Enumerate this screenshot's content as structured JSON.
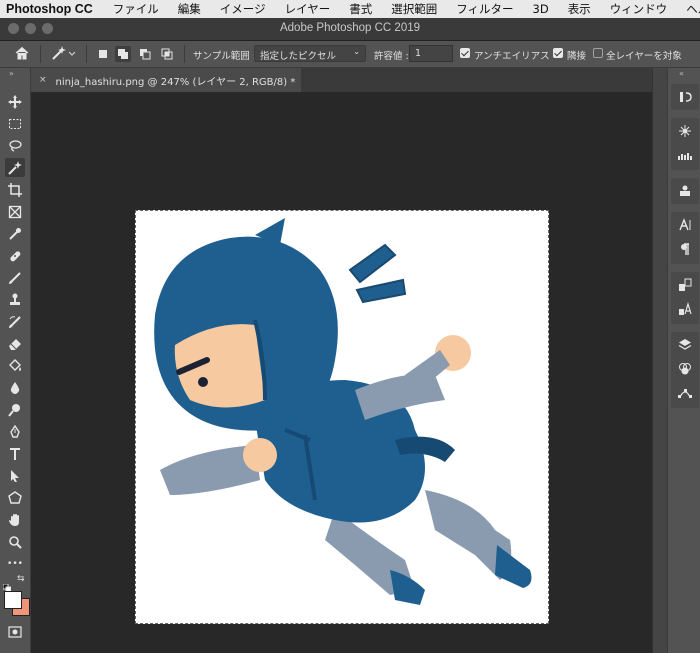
{
  "menubar": {
    "app": "Photoshop CC",
    "items": [
      "ファイル",
      "編集",
      "イメージ",
      "レイヤー",
      "書式",
      "選択範囲",
      "フィルター",
      "3D",
      "表示",
      "ウィンドウ",
      "ヘルプ"
    ]
  },
  "window": {
    "title": "Adobe Photoshop CC 2019"
  },
  "options": {
    "sample_label": "サンプル範囲 :",
    "sample_value": "指定したピクセル",
    "tolerance_label": "許容値 :",
    "tolerance_value": "1",
    "antialias_label": "アンチエイリアス",
    "antialias_checked": true,
    "contiguous_label": "隣接",
    "contiguous_checked": true,
    "all_layers_label": "全レイヤーを対象",
    "all_layers_checked": false
  },
  "document": {
    "tab_title": "ninja_hashiru.png @ 247% (レイヤー 2, RGB/8) *",
    "close_glyph": "×"
  },
  "tools": {
    "active": "magic-wand",
    "list": [
      "move",
      "marquee",
      "lasso",
      "magic-wand",
      "crop",
      "frame",
      "eyedropper",
      "healing",
      "brush",
      "stamp",
      "history-brush",
      "eraser",
      "paint-bucket",
      "blur",
      "dodge",
      "pen",
      "type",
      "path-select",
      "shape",
      "hand",
      "zoom",
      "more"
    ],
    "more_glyph": "•••",
    "foreground_color": "#ffffff",
    "background_color": "#f0957a"
  },
  "colors": {
    "accent": "#2f6fd6",
    "ninja_blue": "#1f5f8f",
    "skin": "#f7c9a0"
  }
}
